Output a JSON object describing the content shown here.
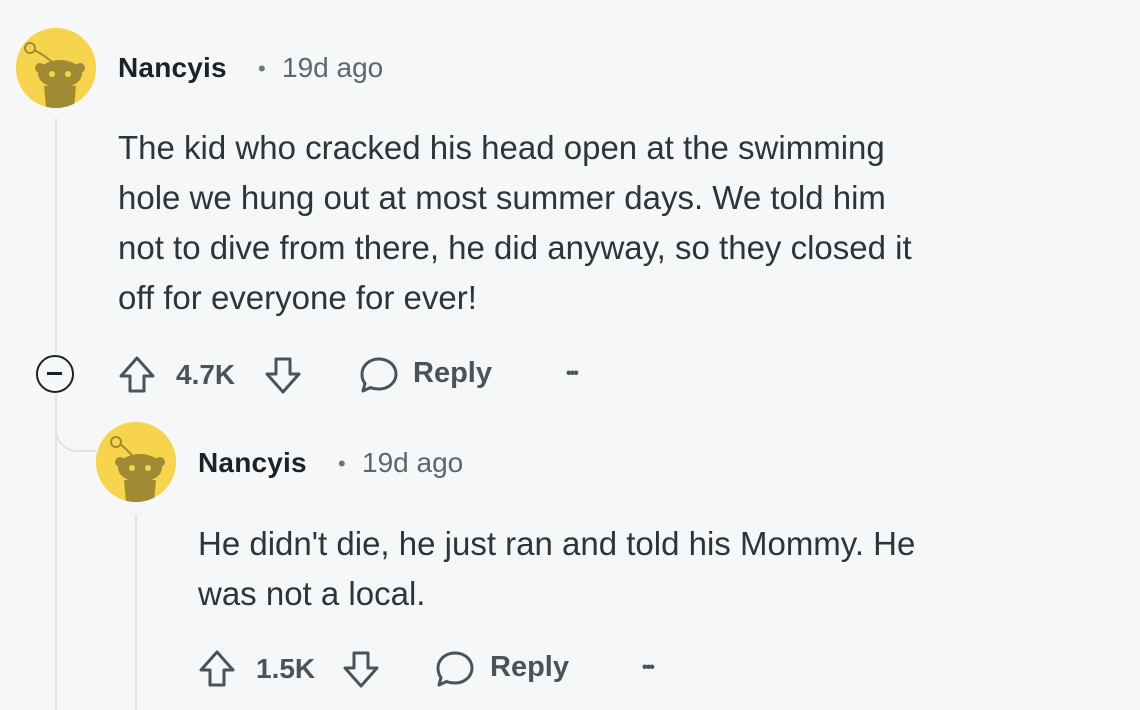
{
  "comments": [
    {
      "username": "Nancyis",
      "separator": "•",
      "timestamp": "19d ago",
      "lines": [
        "The kid who cracked his head open at the swimming",
        "hole we hung out at most summer days. We told him",
        "not to dive from there, he did anyway, so they closed it",
        "off for everyone for ever!"
      ],
      "votes": "4.7K",
      "reply_label": "Reply",
      "more_label": "•••"
    },
    {
      "username": "Nancyis",
      "separator": "•",
      "timestamp": "19d ago",
      "lines": [
        "He didn't die, he just ran and told his Mommy. He",
        "was not a local."
      ],
      "votes": "1.5K",
      "reply_label": "Reply",
      "more_label": "•••"
    }
  ],
  "colors": {
    "background": "#f6f7f8",
    "avatar": "#f6d44c",
    "avatar_figure": "#a08a33",
    "thread_line": "#dfe3e6"
  },
  "icons": [
    "avatar-snoo-icon",
    "collapse-thread-icon",
    "upvote-icon",
    "downvote-icon",
    "reply-icon",
    "more-options-icon"
  ]
}
